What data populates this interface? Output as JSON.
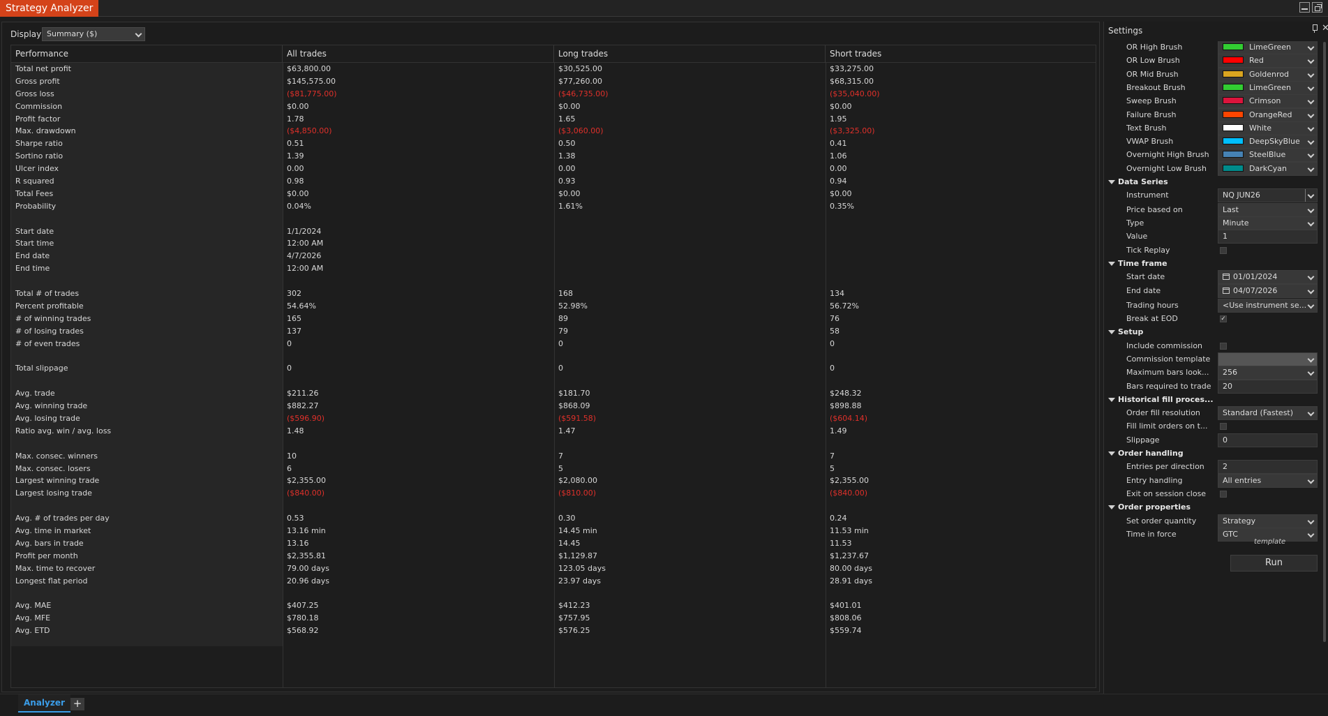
{
  "window": {
    "title": "Strategy Analyzer"
  },
  "display": {
    "label": "Display",
    "value": "Summary ($)"
  },
  "table": {
    "headers": [
      "Performance",
      "All trades",
      "Long trades",
      "Short trades"
    ],
    "rows": [
      {
        "label": "Total net profit",
        "all": "$63,800.00",
        "long": "$30,525.00",
        "short": "$33,275.00"
      },
      {
        "label": "Gross profit",
        "all": "$145,575.00",
        "long": "$77,260.00",
        "short": "$68,315.00"
      },
      {
        "label": "Gross loss",
        "all": "($81,775.00)",
        "long": "($46,735.00)",
        "short": "($35,040.00)",
        "negative": true
      },
      {
        "label": "Commission",
        "all": "$0.00",
        "long": "$0.00",
        "short": "$0.00"
      },
      {
        "label": "Profit factor",
        "all": "1.78",
        "long": "1.65",
        "short": "1.95"
      },
      {
        "label": "Max. drawdown",
        "all": "($4,850.00)",
        "long": "($3,060.00)",
        "short": "($3,325.00)",
        "negative": true
      },
      {
        "label": "Sharpe ratio",
        "all": "0.51",
        "long": "0.50",
        "short": "0.41"
      },
      {
        "label": "Sortino ratio",
        "all": "1.39",
        "long": "1.38",
        "short": "1.06"
      },
      {
        "label": "Ulcer index",
        "all": "0.00",
        "long": "0.00",
        "short": "0.00"
      },
      {
        "label": "R squared",
        "all": "0.98",
        "long": "0.93",
        "short": "0.94"
      },
      {
        "label": "Total Fees",
        "all": "$0.00",
        "long": "$0.00",
        "short": "$0.00"
      },
      {
        "label": "Probability",
        "all": "0.04%",
        "long": "1.61%",
        "short": "0.35%"
      },
      {
        "label": "",
        "all": "",
        "long": "",
        "short": ""
      },
      {
        "label": "Start date",
        "all": "1/1/2024",
        "long": "",
        "short": ""
      },
      {
        "label": "Start time",
        "all": "12:00 AM",
        "long": "",
        "short": ""
      },
      {
        "label": "End date",
        "all": "4/7/2026",
        "long": "",
        "short": ""
      },
      {
        "label": "End time",
        "all": "12:00 AM",
        "long": "",
        "short": ""
      },
      {
        "label": "",
        "all": "",
        "long": "",
        "short": ""
      },
      {
        "label": "Total # of trades",
        "all": "302",
        "long": "168",
        "short": "134"
      },
      {
        "label": "Percent profitable",
        "all": "54.64%",
        "long": "52.98%",
        "short": "56.72%"
      },
      {
        "label": "# of winning trades",
        "all": "165",
        "long": "89",
        "short": "76"
      },
      {
        "label": "# of losing trades",
        "all": "137",
        "long": "79",
        "short": "58"
      },
      {
        "label": "# of even trades",
        "all": "0",
        "long": "0",
        "short": "0"
      },
      {
        "label": "",
        "all": "",
        "long": "",
        "short": ""
      },
      {
        "label": "Total slippage",
        "all": "0",
        "long": "0",
        "short": "0"
      },
      {
        "label": "",
        "all": "",
        "long": "",
        "short": ""
      },
      {
        "label": "Avg. trade",
        "all": "$211.26",
        "long": "$181.70",
        "short": "$248.32"
      },
      {
        "label": "Avg. winning trade",
        "all": "$882.27",
        "long": "$868.09",
        "short": "$898.88"
      },
      {
        "label": "Avg. losing trade",
        "all": "($596.90)",
        "long": "($591.58)",
        "short": "($604.14)",
        "negative": true
      },
      {
        "label": "Ratio avg. win / avg. loss",
        "all": "1.48",
        "long": "1.47",
        "short": "1.49"
      },
      {
        "label": "",
        "all": "",
        "long": "",
        "short": ""
      },
      {
        "label": "Max. consec. winners",
        "all": "10",
        "long": "7",
        "short": "7"
      },
      {
        "label": "Max. consec. losers",
        "all": "6",
        "long": "5",
        "short": "5"
      },
      {
        "label": "Largest winning trade",
        "all": "$2,355.00",
        "long": "$2,080.00",
        "short": "$2,355.00"
      },
      {
        "label": "Largest losing trade",
        "all": "($840.00)",
        "long": "($810.00)",
        "short": "($840.00)",
        "negative": true
      },
      {
        "label": "",
        "all": "",
        "long": "",
        "short": ""
      },
      {
        "label": "Avg. # of trades per day",
        "all": "0.53",
        "long": "0.30",
        "short": "0.24"
      },
      {
        "label": "Avg. time in market",
        "all": "13.16 min",
        "long": "14.45 min",
        "short": "11.53 min"
      },
      {
        "label": "Avg. bars in trade",
        "all": "13.16",
        "long": "14.45",
        "short": "11.53"
      },
      {
        "label": "Profit per month",
        "all": "$2,355.81",
        "long": "$1,129.87",
        "short": "$1,237.67"
      },
      {
        "label": "Max. time to recover",
        "all": "79.00 days",
        "long": "123.05 days",
        "short": "80.00 days"
      },
      {
        "label": "Longest flat period",
        "all": "20.96 days",
        "long": "23.97 days",
        "short": "28.91 days"
      },
      {
        "label": "",
        "all": "",
        "long": "",
        "short": ""
      },
      {
        "label": "Avg. MAE",
        "all": "$407.25",
        "long": "$412.23",
        "short": "$401.01"
      },
      {
        "label": "Avg. MFE",
        "all": "$780.18",
        "long": "$757.95",
        "short": "$808.06"
      },
      {
        "label": "Avg. ETD",
        "all": "$568.92",
        "long": "$576.25",
        "short": "$559.74"
      }
    ]
  },
  "settings": {
    "title": "Settings",
    "items": [
      {
        "kind": "prop",
        "label": "OR High Brush",
        "type": "color",
        "value": "LimeGreen",
        "color": "#32cd32"
      },
      {
        "kind": "prop",
        "label": "OR Low Brush",
        "type": "color",
        "value": "Red",
        "color": "#ff0000"
      },
      {
        "kind": "prop",
        "label": "OR Mid Brush",
        "type": "color",
        "value": "Goldenrod",
        "color": "#daa520"
      },
      {
        "kind": "prop",
        "label": "Breakout Brush",
        "type": "color",
        "value": "LimeGreen",
        "color": "#32cd32"
      },
      {
        "kind": "prop",
        "label": "Sweep Brush",
        "type": "color",
        "value": "Crimson",
        "color": "#dc143c"
      },
      {
        "kind": "prop",
        "label": "Failure Brush",
        "type": "color",
        "value": "OrangeRed",
        "color": "#ff4500"
      },
      {
        "kind": "prop",
        "label": "Text Brush",
        "type": "color",
        "value": "White",
        "color": "#ffffff"
      },
      {
        "kind": "prop",
        "label": "VWAP Brush",
        "type": "color",
        "value": "DeepSkyBlue",
        "color": "#00bfff"
      },
      {
        "kind": "prop",
        "label": "Overnight High Brush",
        "type": "color",
        "value": "SteelBlue",
        "color": "#4682b4"
      },
      {
        "kind": "prop",
        "label": "Overnight Low Brush",
        "type": "color",
        "value": "DarkCyan",
        "color": "#008b8b"
      },
      {
        "kind": "cat",
        "label": "Data Series"
      },
      {
        "kind": "prop",
        "label": "Instrument",
        "type": "split",
        "value": "NQ JUN26"
      },
      {
        "kind": "prop",
        "label": "Price based on",
        "type": "dropdown",
        "value": "Last"
      },
      {
        "kind": "prop",
        "label": "Type",
        "type": "dropdown",
        "value": "Minute"
      },
      {
        "kind": "prop",
        "label": "Value",
        "type": "text",
        "value": "1"
      },
      {
        "kind": "prop",
        "label": "Tick Replay",
        "type": "check",
        "checked": false
      },
      {
        "kind": "cat",
        "label": "Time frame"
      },
      {
        "kind": "prop",
        "label": "Start date",
        "type": "date",
        "value": "01/01/2024"
      },
      {
        "kind": "prop",
        "label": "End date",
        "type": "date",
        "value": "04/07/2026"
      },
      {
        "kind": "prop",
        "label": "Trading hours",
        "type": "dropdown",
        "value": "<Use instrument se..."
      },
      {
        "kind": "prop",
        "label": "Break at EOD",
        "type": "check",
        "checked": true
      },
      {
        "kind": "cat",
        "label": "Setup"
      },
      {
        "kind": "prop",
        "label": "Include commission",
        "type": "check",
        "checked": false
      },
      {
        "kind": "prop",
        "label": "Commission template",
        "type": "disabled",
        "value": ""
      },
      {
        "kind": "prop",
        "label": "Maximum bars look...",
        "type": "dropdown",
        "value": "256"
      },
      {
        "kind": "prop",
        "label": "Bars required to trade",
        "type": "text",
        "value": "20"
      },
      {
        "kind": "cat",
        "label": "Historical fill proces..."
      },
      {
        "kind": "prop",
        "label": "Order fill resolution",
        "type": "dropdown",
        "value": "Standard (Fastest)"
      },
      {
        "kind": "prop",
        "label": "Fill limit orders on t...",
        "type": "check",
        "checked": false
      },
      {
        "kind": "prop",
        "label": "Slippage",
        "type": "text",
        "value": "0"
      },
      {
        "kind": "cat",
        "label": "Order handling"
      },
      {
        "kind": "prop",
        "label": "Entries per direction",
        "type": "text",
        "value": "2"
      },
      {
        "kind": "prop",
        "label": "Entry handling",
        "type": "dropdown",
        "value": "All entries"
      },
      {
        "kind": "prop",
        "label": "Exit on session close",
        "type": "check",
        "checked": false
      },
      {
        "kind": "cat",
        "label": "Order properties"
      },
      {
        "kind": "prop",
        "label": "Set order quantity",
        "type": "dropdown",
        "value": "Strategy"
      },
      {
        "kind": "prop",
        "label": "Time in force",
        "type": "dropdown",
        "value": "GTC"
      }
    ],
    "template_label": "template",
    "run_label": "Run"
  },
  "tabs": {
    "active": "Analyzer",
    "add": "+"
  }
}
